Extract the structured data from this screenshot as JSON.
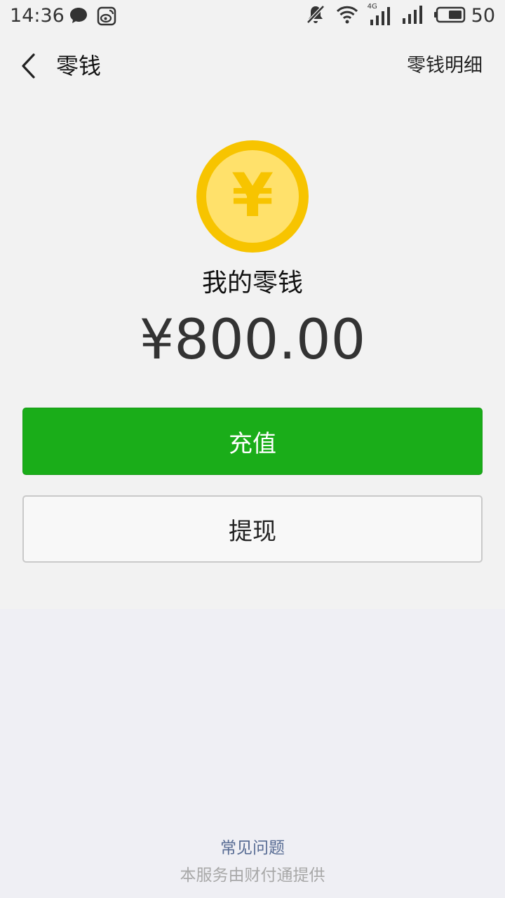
{
  "status_bar": {
    "time": "14:36",
    "left_icons": [
      "chat-bubble-icon",
      "weibo-icon"
    ],
    "right_icons": [
      "bell-muted-icon",
      "wifi-icon",
      "signal-4g-icon",
      "signal-icon",
      "battery-icon"
    ],
    "network_label": "4G",
    "battery_level": "50"
  },
  "nav": {
    "back_icon": "chevron-left-icon",
    "title": "零钱",
    "right_link": "零钱明细"
  },
  "balance": {
    "icon": "yuan-coin-icon",
    "coin_symbol": "¥",
    "label": "我的零钱",
    "amount": "¥800.00"
  },
  "actions": {
    "recharge_label": "充值",
    "withdraw_label": "提现"
  },
  "footer": {
    "faq_label": "常见问题",
    "provider": "本服务由财付通提供"
  },
  "colors": {
    "primary_green": "#1aad19",
    "coin_outer": "#f7c400",
    "coin_inner": "#ffe16b",
    "link_blue": "#586c94"
  }
}
